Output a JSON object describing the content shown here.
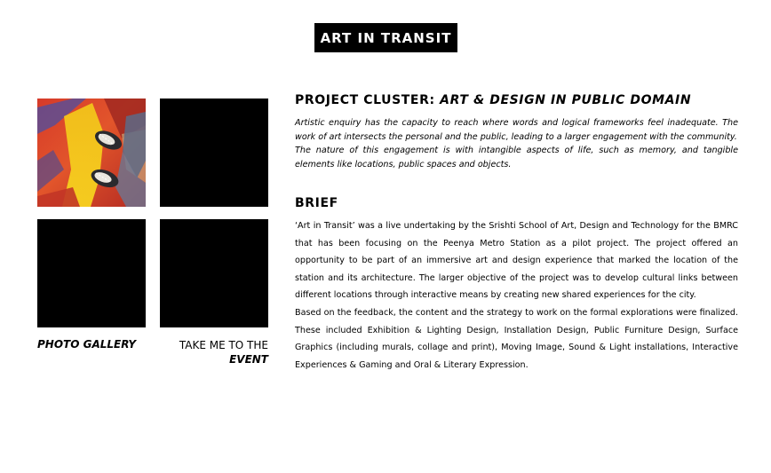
{
  "header": {
    "title": "ART IN TRANSIT"
  },
  "gallery": {
    "tiles": [
      {
        "description": "photo",
        "image": "feet-on-painted-floor"
      },
      {
        "description": "",
        "image": "black"
      },
      {
        "description": "",
        "image": "black"
      },
      {
        "description": "",
        "image": "black"
      }
    ],
    "photo_gallery_label": "PHOTO GALLERY",
    "event_label_line1": "TAKE ME TO THE",
    "event_label_line2": "EVENT"
  },
  "cluster": {
    "heading_prefix": "PROJECT CLUSTER:",
    "heading_title": "ART & DESIGN IN PUBLIC DOMAIN",
    "paragraph1": "Artistic enquiry has the capacity to reach where words and logical frameworks feel inadequate. The work of art intersects the personal and the public, leading to a larger engagement with the community.",
    "paragraph2": "The nature of this engagement is with intangible aspects of life, such as memory, and tangible elements like locations, public spaces and objects."
  },
  "brief": {
    "heading": "BRIEF",
    "paragraph1": "‘Art  in Transit’ was a live undertaking by the Srishti School of Art, Design and Technology for the BMRC that has been focusing on the Peenya Metro Station as a pilot project. The project offered an opportunity to be part of an immersive art and design experience that marked the location of the station and its architecture.  The larger objective of the project was to develop cultural links between different locations through interactive means by creating new shared experiences for the city.",
    "paragraph2": "Based on the feedback, the content and the strategy to work on the formal explorations were finalized.  These included Exhibition & Lighting Design, Installation Design, Public Furniture Design, Surface Graphics (including murals, collage and print), Moving Image, Sound & Light installations, Interactive Experiences & Gaming and Oral & Literary Expression."
  },
  "colors": {
    "background": "#ffffff",
    "text": "#000000",
    "badge_bg": "#000000",
    "badge_text": "#ffffff"
  }
}
